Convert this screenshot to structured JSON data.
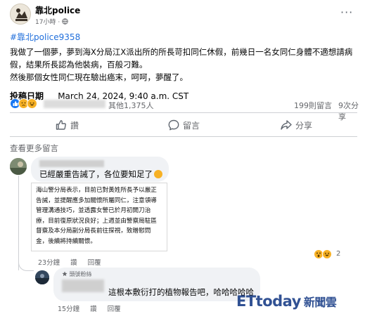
{
  "post": {
    "page_name": "靠北police",
    "time": "17小時 ·",
    "more_icon": "···",
    "hashtag": "#靠北police9358",
    "body_lines": [
      "我做了一個夢，夢到海X分局江X派出所的所長苛扣同仁休假，前幾日一名女同仁身體不適想請病",
      "假，結果所長認為他裝病，百般刁難。",
      "然後那個女性同仁現在驗出癌末，呵呵，夢醒了。"
    ],
    "date_label": "投稿日期",
    "date_value": "March 24, 2024, 9:40 a.m. CST"
  },
  "stats": {
    "others": "其他1,375人",
    "comments": "199則留言",
    "shares": "9次分享"
  },
  "actions": {
    "like": "讚",
    "comment": "留言",
    "share": "分享"
  },
  "view_more": "查看更多留言",
  "comment1": {
    "text": "已經嚴重告誡了，各位要知足了",
    "quote_lines": [
      "海山警分局表示，目前已對黃姓所長予以嚴正",
      "告誡，並提醒應多加關懷所屬同仁，注意領導",
      "管理溝通技巧，並透露女警已於月初開刀治",
      "療，目前復原狀況良好；上週並由警察局駐區",
      "督察及本分局副分局長前往探視，致贈慰問",
      "金，後續將持續關懷。"
    ],
    "time": "23分鐘",
    "like": "讚",
    "reply": "回覆",
    "reaction_count": "2"
  },
  "comment2": {
    "badge": "頭號粉絲",
    "text": "這根本敷衍打的植物報告吧，哈哈哈哈哈",
    "time": "15分鐘",
    "like": "讚",
    "reply": "回覆"
  },
  "watermark": {
    "brand": "ETtoday",
    "suffix": "新聞雲"
  },
  "colors": {
    "link": "#216fdb",
    "like_blue": "#1877f2",
    "emoji_yellow": "#f7b125",
    "muted": "#65676b"
  }
}
